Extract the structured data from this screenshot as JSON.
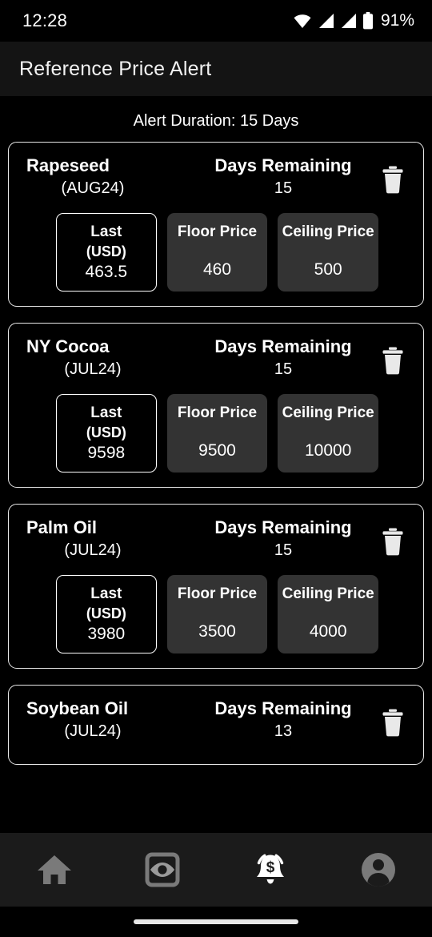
{
  "status_bar": {
    "time": "12:28",
    "battery_text": "91%",
    "icons": [
      "wifi-icon",
      "signal-icon",
      "signal-icon",
      "battery-icon"
    ]
  },
  "app_bar": {
    "title": "Reference Price Alert"
  },
  "duration_banner": {
    "text": "Alert Duration: 15 Days"
  },
  "labels": {
    "days_remaining": "Days Remaining",
    "last": "Last",
    "last_currency": "(USD)",
    "floor_price": "Floor Price",
    "ceiling_price": "Ceiling Price",
    "delete": "delete-alert"
  },
  "alerts": [
    {
      "name": "Rapeseed",
      "contract": "(AUG24)",
      "days_remaining": "15",
      "last": "463.5",
      "floor": "460",
      "ceiling": "500"
    },
    {
      "name": "NY Cocoa",
      "contract": "(JUL24)",
      "days_remaining": "15",
      "last": "9598",
      "floor": "9500",
      "ceiling": "10000"
    },
    {
      "name": "Palm Oil",
      "contract": "(JUL24)",
      "days_remaining": "15",
      "last": "3980",
      "floor": "3500",
      "ceiling": "4000"
    },
    {
      "name": "Soybean Oil",
      "contract": "(JUL24)",
      "days_remaining": "13",
      "last": "",
      "floor": "",
      "ceiling": ""
    }
  ],
  "bottom_nav": {
    "items": [
      {
        "icon": "home-icon",
        "active": false
      },
      {
        "icon": "watchlist-eye-icon",
        "active": false
      },
      {
        "icon": "alert-bell-dollar-icon",
        "active": true
      },
      {
        "icon": "account-person-icon",
        "active": false
      }
    ]
  },
  "colors": {
    "background": "#000000",
    "app_bar": "#141414",
    "card_border": "#e8e8e8",
    "price_box_shaded": "#333333",
    "nav_bar": "#1b1b1b",
    "nav_icon_inactive": "#7a7a7a",
    "nav_icon_active": "#ffffff",
    "text": "#ffffff"
  }
}
